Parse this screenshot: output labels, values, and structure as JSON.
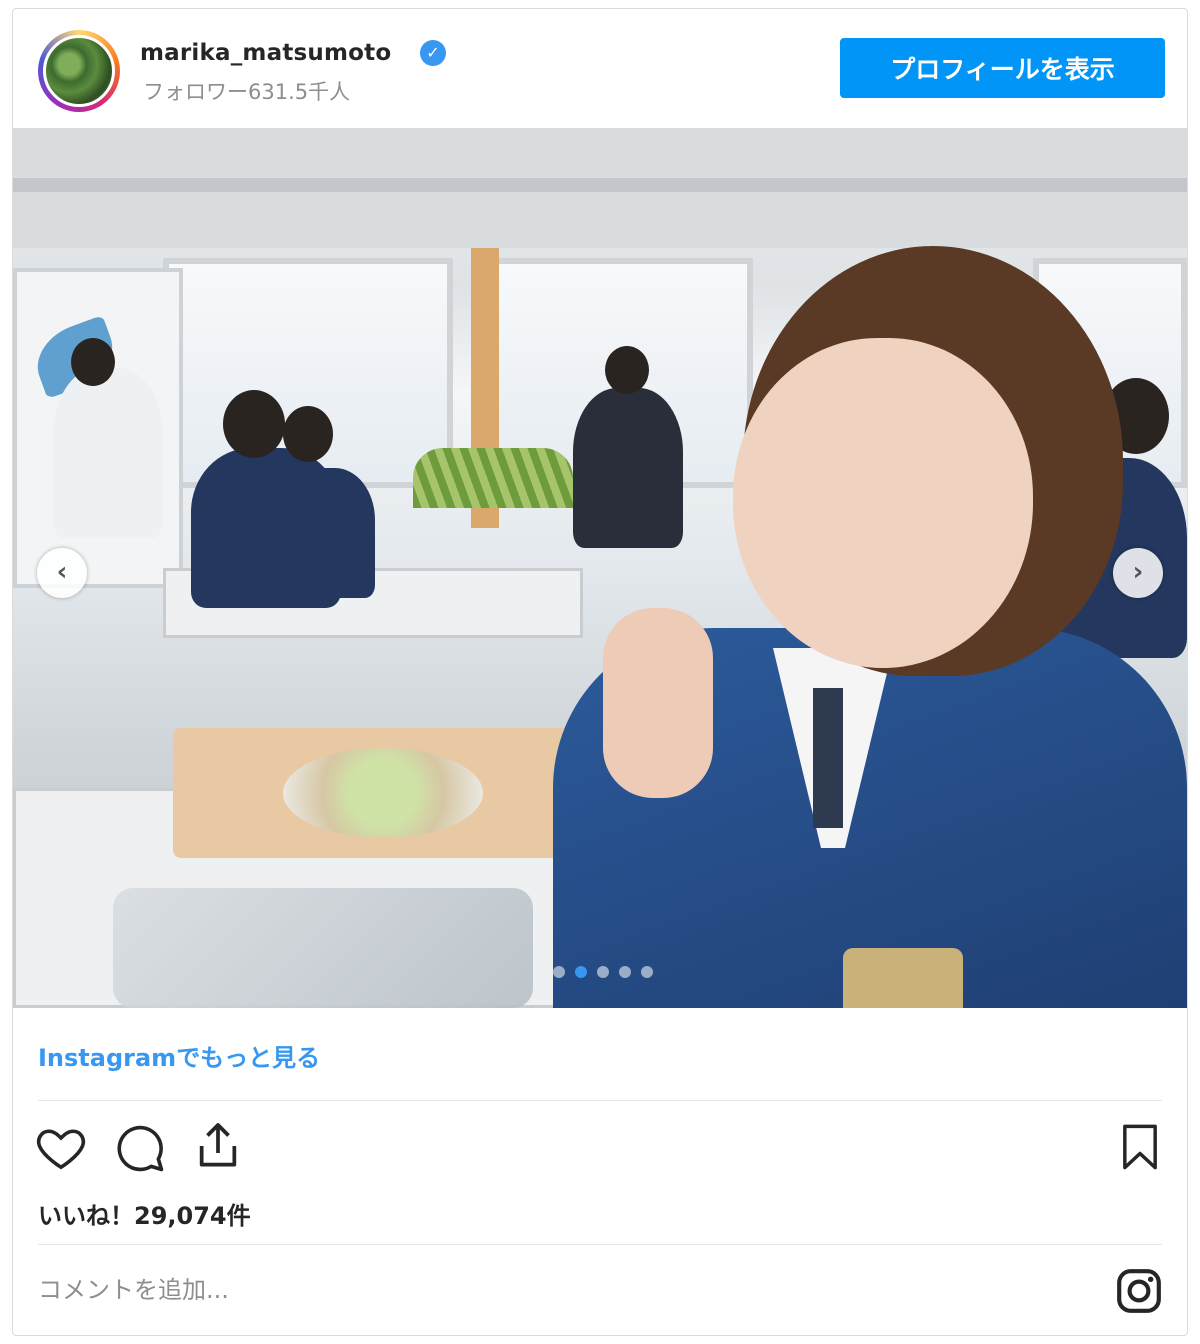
{
  "header": {
    "username": "marika_matsumoto",
    "verified_icon": "✓",
    "followers": "フォロワー631.5千人",
    "profile_button": "プロフィールを表示"
  },
  "post": {
    "carousel_prev": "‹",
    "carousel_next": "›",
    "carousel_total": 5,
    "carousel_active": 2
  },
  "footer": {
    "more_link": "Instagramでもっと見る",
    "likes": "いいね！29,074件",
    "comment_placeholder": "コメントを追加..."
  },
  "icons": [
    "heart-icon",
    "comment-icon",
    "share-icon",
    "bookmark-icon",
    "instagram-icon",
    "verified-icon"
  ],
  "colors": {
    "accent": "#0095f6",
    "link": "#3897f0",
    "muted": "#8e8e8e"
  }
}
